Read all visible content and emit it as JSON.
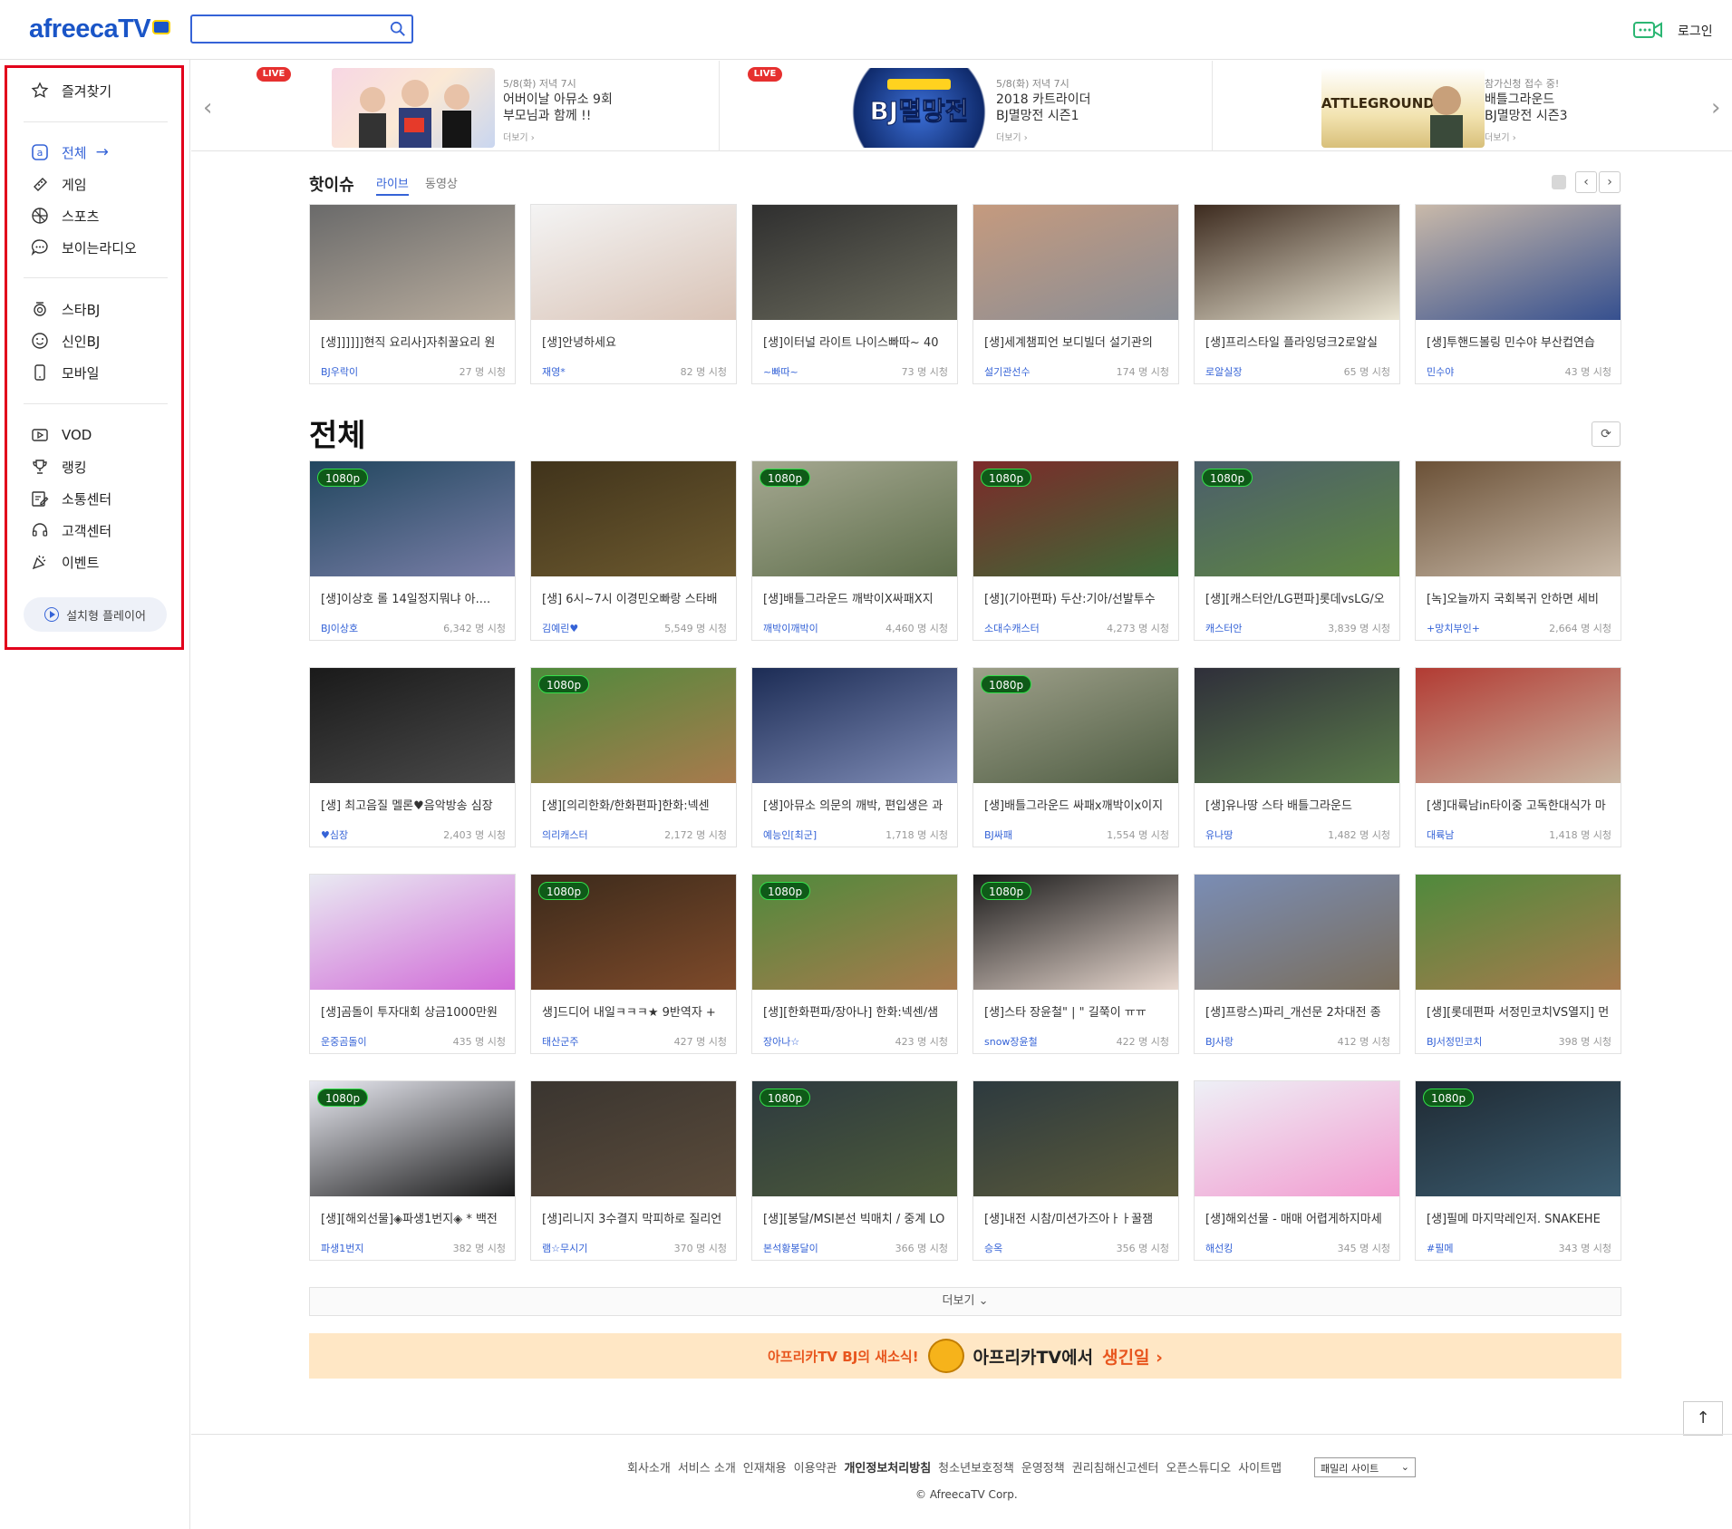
{
  "header": {
    "logo_text": "afreecaTV",
    "search_placeholder": "",
    "login_label": "로그인"
  },
  "sidebar": {
    "items": [
      {
        "label": "즐겨찾기",
        "icon": "star-icon"
      },
      {
        "label": "전체",
        "icon": "all-icon",
        "active": true
      },
      {
        "label": "게임",
        "icon": "game-icon"
      },
      {
        "label": "스포츠",
        "icon": "sports-icon"
      },
      {
        "label": "보이는라디오",
        "icon": "radio-icon"
      },
      {
        "label": "스타BJ",
        "icon": "star-bj-icon"
      },
      {
        "label": "신인BJ",
        "icon": "smile-icon"
      },
      {
        "label": "모바일",
        "icon": "mobile-icon"
      },
      {
        "label": "VOD",
        "icon": "vod-icon"
      },
      {
        "label": "랭킹",
        "icon": "trophy-icon"
      },
      {
        "label": "소통센터",
        "icon": "edit-icon"
      },
      {
        "label": "고객센터",
        "icon": "headset-icon"
      },
      {
        "label": "이벤트",
        "icon": "event-icon"
      }
    ],
    "player_label": "설치형 플레이어"
  },
  "banners": [
    {
      "live": "LIVE",
      "sub": "5/8(화) 저녁 7시",
      "title1": "어버이날 아뮤소 9회",
      "title2": "부모님과 함께 !!",
      "more": "더보기 ›"
    },
    {
      "live": "LIVE",
      "sub": "5/8(화) 저녁 7시",
      "title1": "2018 카트라이더",
      "title2": "BJ멸망전 시즌1",
      "more": "더보기 ›",
      "art": "BJ멸망전"
    },
    {
      "live": "",
      "sub": "참가신청 접수 중!",
      "title1": "배틀그라운드",
      "title2": "BJ멸망전 시즌3",
      "more": "더보기 ›",
      "art": "BATTLEGROUNDS"
    }
  ],
  "hot": {
    "title": "핫이슈",
    "tabs": [
      "라이브",
      "동영상"
    ],
    "cards": [
      {
        "title": "[생]]]]]]현직 요리사]자취꿀요리 원",
        "nick": "BJ우락이",
        "views": "27 명 시청",
        "q": "",
        "colors": [
          "#6a6a6a",
          "#b9ad9e"
        ]
      },
      {
        "title": "[생]안녕하세요",
        "nick": "재영*",
        "views": "82 명 시청",
        "q": "",
        "colors": [
          "#f4f4f4",
          "#d9c3b6"
        ]
      },
      {
        "title": "[생]이터널 라이트 나이스빠따~ 40",
        "nick": "~빠따~",
        "views": "73 명 시청",
        "q": "",
        "colors": [
          "#2f2f2f",
          "#6b6b5d"
        ]
      },
      {
        "title": "[생]세계챔피언 보디빌더 설기관의",
        "nick": "설기관선수",
        "views": "174 명 시청",
        "q": "",
        "colors": [
          "#c59a7e",
          "#8a8e96"
        ]
      },
      {
        "title": "[생]프리스타일 플라잉덩크2로알실",
        "nick": "로알실장",
        "views": "65 명 시청",
        "q": "",
        "colors": [
          "#3d2b1f",
          "#e9e4d2"
        ]
      },
      {
        "title": "[생]투핸드볼링 민수야 부산컵연습",
        "nick": "민수야",
        "views": "43 명 시청",
        "q": "",
        "colors": [
          "#c9b9a9",
          "#36508f"
        ]
      }
    ]
  },
  "all": {
    "title": "전체",
    "cards": [
      {
        "title": "[생]이상호 롤 14일정지뭐냐 아....",
        "nick": "BJ이상호",
        "views": "6,342 명 시청",
        "q": "1080p",
        "colors": [
          "#21465e",
          "#7a7fa8"
        ]
      },
      {
        "title": "[생] 6시~7시 이경민오빠랑 스타배",
        "nick": "김예린♥",
        "views": "5,549 명 시청",
        "q": "",
        "colors": [
          "#40331b",
          "#6d5a2f"
        ]
      },
      {
        "title": "[생]배틀그라운드 깨박이X싸패X지",
        "nick": "깨박이깨박이",
        "views": "4,460 명 시청",
        "q": "1080p",
        "colors": [
          "#a5a891",
          "#5e6e4b"
        ]
      },
      {
        "title": "[생](기아편파) 두산:기아/선발투수",
        "nick": "소대수캐스터",
        "views": "4,273 명 시청",
        "q": "1080p",
        "colors": [
          "#7c2a2a",
          "#3d6a37"
        ]
      },
      {
        "title": "[생][캐스터안/LG편파]롯데vsLG/오",
        "nick": "캐스터안",
        "views": "3,839 명 시청",
        "q": "1080p",
        "colors": [
          "#4b5e6b",
          "#5f8742"
        ]
      },
      {
        "title": "[녹]오늘까지 국회복귀 안하면 세비",
        "nick": "+망치부인+",
        "views": "2,664 명 시청",
        "q": "",
        "colors": [
          "#6b5137",
          "#c8b9a8"
        ]
      },
      {
        "title": "[생] 최고음질 멜론♥음악방송 심장",
        "nick": "♥심장",
        "views": "2,403 명 시청",
        "q": "",
        "colors": [
          "#1a1a1a",
          "#4a4a4a"
        ]
      },
      {
        "title": "[생][의리한화/한화편파]한화:넥센",
        "nick": "의리캐스터",
        "views": "2,172 명 시청",
        "q": "1080p",
        "colors": [
          "#4f8a3c",
          "#a87a4d"
        ]
      },
      {
        "title": "[생]아뮤소 의문의 깨박, 편입생은 과",
        "nick": "예능인[최군]",
        "views": "1,718 명 시청",
        "q": "",
        "colors": [
          "#1c2c55",
          "#7e8bb5"
        ]
      },
      {
        "title": "[생]배틀그라운드 싸패x깨박이x이지",
        "nick": "BJ싸패",
        "views": "1,554 명 시청",
        "q": "1080p",
        "colors": [
          "#9ea08a",
          "#4f5d43"
        ]
      },
      {
        "title": "[생]유나땅 스타 배틀그라운드",
        "nick": "유나땅",
        "views": "1,482 명 시청",
        "q": "",
        "colors": [
          "#2f2f3a",
          "#5a7a4a"
        ]
      },
      {
        "title": "[생]대륙남in타이중 고독한대식가 마",
        "nick": "대륙남",
        "views": "1,418 명 시청",
        "q": "",
        "colors": [
          "#b23b33",
          "#c9b5a1"
        ]
      },
      {
        "title": "[생]곰돌이 투자대회 상금1000만원",
        "nick": "운중곰돌이",
        "views": "435 명 시청",
        "q": "",
        "colors": [
          "#e9eaf2",
          "#d06ad7"
        ]
      },
      {
        "title": "생]드디어 내일ㅋㅋㅋ★ 9반역자 +",
        "nick": "태산군주",
        "views": "427 명 시청",
        "q": "1080p",
        "colors": [
          "#3b2a1b",
          "#7e4a2a"
        ]
      },
      {
        "title": "[생][한화편파/장아나] 한화:넥센/샘",
        "nick": "장아나☆",
        "views": "423 명 시청",
        "q": "1080p",
        "colors": [
          "#4f8a3c",
          "#a87a4d"
        ]
      },
      {
        "title": "[생]스타 장윤철\" | \" 길쭉이 ㅠㅠ",
        "nick": "snow장윤철",
        "views": "422 명 시청",
        "q": "1080p",
        "colors": [
          "#1a1a1a",
          "#e8d8cf"
        ]
      },
      {
        "title": "[생]프랑스)파리_개선문 2차대전 종",
        "nick": "BJ사랑",
        "views": "412 명 시청",
        "q": "",
        "colors": [
          "#7a8db5",
          "#7a6e5c"
        ]
      },
      {
        "title": "[생][롯데편파 서정민코치VS열지] 먼",
        "nick": "BJ서정민코치",
        "views": "398 명 시청",
        "q": "",
        "colors": [
          "#4f8a3c",
          "#a87a4d"
        ]
      },
      {
        "title": "[생][해외선물]◈파생1번지◈ * 백전",
        "nick": "파생1번지",
        "views": "382 명 시청",
        "q": "1080p",
        "colors": [
          "#e9eaf2",
          "#1a1a1a"
        ]
      },
      {
        "title": "[생]리니지 3수결지 막피하로 질리언",
        "nick": "램☆무시기",
        "views": "370 명 시청",
        "q": "",
        "colors": [
          "#3a3530",
          "#5b4b3a"
        ]
      },
      {
        "title": "[생][봉달/MSI본선 빅매치 / 중계 LO",
        "nick": "본석황봉달이",
        "views": "366 명 시청",
        "q": "1080p",
        "colors": [
          "#2d3a3f",
          "#4d5a3a"
        ]
      },
      {
        "title": "[생]내전 시참/미션가즈아ㅏㅏ꿀잼",
        "nick": "승옥",
        "views": "356 명 시청",
        "q": "",
        "colors": [
          "#2d3a3f",
          "#5b5a3a"
        ]
      },
      {
        "title": "[생]해외선물 - 매매 어렵게하지마세",
        "nick": "해선킹",
        "views": "345 명 시청",
        "q": "",
        "colors": [
          "#eef0f6",
          "#f29bd0"
        ]
      },
      {
        "title": "[생]필메 마지막레인저. SNAKEHE",
        "nick": "#필메",
        "views": "343 명 시청",
        "q": "1080p",
        "colors": [
          "#1f2a33",
          "#3b5c70"
        ]
      }
    ]
  },
  "more_label": "더보기",
  "promo": {
    "text1": "아프리카TV BJ의 새소식!",
    "text2": "아프리카TV에서",
    "text3": "생긴일 ›"
  },
  "footer": {
    "links": [
      "회사소개",
      "서비스 소개",
      "인재채용",
      "이용약관",
      "개인정보처리방침",
      "청소년보호정책",
      "운영정책",
      "권리침해신고센터",
      "오픈스튜디오",
      "사이트맵"
    ],
    "family_site": "패밀리 사이트",
    "copyright": "© AfreecaTV Corp."
  },
  "colors": {
    "accent": "#3563d7",
    "live": "#e6302f",
    "highlight": "#e2001b"
  }
}
